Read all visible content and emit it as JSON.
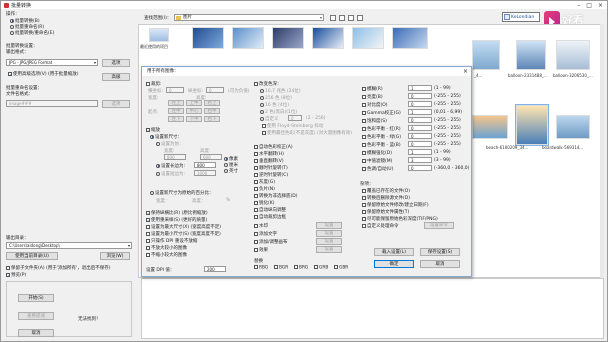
{
  "window": {
    "title": "批量转换"
  },
  "left": {
    "operation_label": "操作：",
    "ops": [
      {
        "label": "批量转换(B)",
        "selected": true
      },
      {
        "label": "批量重命名(R)",
        "selected": false
      },
      {
        "label": "批量转换/重命名(E)",
        "selected": false
      }
    ],
    "settings_label": "批量转换设置：",
    "output_format_label": "输出格式：",
    "format_value": "JPG - JPG/JPEG Format",
    "format_options_btn": "选项",
    "adv_check": "使用高级选项(V) (用于批量缩放)",
    "adv_btn": "高级",
    "rename_label": "批量重命名设置：",
    "name_pattern_label": "文件名格式：",
    "name_pattern_value": "image###",
    "name_options_btn": "选项",
    "output_dir_label": "输出目录：",
    "output_dir_value": "C:\\Users\\aidong\\Desktop\\",
    "use_current_dir_btn": "使用当前目录(U)",
    "browse_btn": "浏览(W)",
    "keep_subdirs_check": "保留子文件夹(A) (用于'添加所有'，退出后不保存)",
    "preview_check": "预览(P)",
    "start_btn": "开始(S)",
    "preview_btn": "查看提速",
    "cancel_btn": "取消",
    "status_text": "无法找到！"
  },
  "topbar": {
    "lookin_label": "查找范围(I)：",
    "path_value": "图片",
    "search_value": "KeLondian"
  },
  "thumbs": [
    {
      "label": "最近使用的项目"
    },
    {
      "label": ""
    },
    {
      "label": ""
    },
    {
      "label": ""
    },
    {
      "label": ""
    },
    {
      "label": ""
    },
    {
      "label": ""
    },
    {
      "label": "_4..."
    },
    {
      "label": "balloon-2331488_..."
    },
    {
      "label": "balloon-3206530_..."
    },
    {
      "label": "beach-6100209_34..."
    },
    {
      "label": "boardwalk-569314..."
    }
  ],
  "dialog": {
    "title": "用于所有图像：",
    "crop_check": "裁剪:",
    "crop_fields": {
      "start_x": "横坐标:",
      "start_y": "纵坐标:",
      "x_val": "0",
      "y_val": "0",
      "can_neg": "(可为负值)",
      "width": "宽度:",
      "height": "高度:"
    },
    "origin_label": "起点:",
    "origin_opts": [
      "左上",
      "上中",
      "右上",
      "左中",
      "中心",
      "右中",
      "左下",
      "下中",
      "右下"
    ],
    "resize_check": "缩放",
    "set_size_radio": "设置新尺寸：",
    "set_size_sub": "设置为仿：",
    "width_lbl": "宽度:",
    "height_lbl": "高度:",
    "w_val": "800",
    "h_val": "600",
    "set_long_radio": "设置长边为:",
    "long_val": "800",
    "unit_opts": [
      "像素",
      "厘米",
      "英寸"
    ],
    "set_short_radio": "设置短边为:",
    "short_val": "1000",
    "set_percent_radio": "设置新尺寸为原始的百分比：",
    "pct_w": "宽度：",
    "pct_h": "高度：",
    "pct_unit": "%",
    "keep_ratio_check": "保持纵横比(R) (原比例缩放)",
    "resample_check": "使用重采样(S) (更好的质量)",
    "apply_big_check": "设置为最大尺寸(X) (宽度高度不足)",
    "apply_small_check": "设置为最小尺寸(S) (宽度高度不足)",
    "dpi_check": "只操作 DPI 重设不放缩",
    "no_enlarge_check": "不放大较小的图像",
    "no_shrink_check": "不缩小较大的图像",
    "dpi_label": "设置 DPI 值：",
    "dpi_val": "200",
    "color_depth_check": "改变色深：",
    "depths": [
      "16,7 兆色 (24位)",
      "256 色 (8位)",
      "16 色 (4位)",
      "2 色(黑白)(1位)",
      "自定义"
    ],
    "depth_custom_val": "0",
    "depth_range": "(2 - 256)",
    "dither_check": "使用 Floyd-Steinberg 抖动",
    "best_check": "使用最佳色彩(不是灰度) (对大量图像有效)",
    "mid_checks": [
      "自动色彩校正(A)",
      "水平翻转(H)",
      "垂直翻转(V)",
      "顺时针旋转(T)",
      "逆时针旋转(C)",
      "灰度(G)",
      "负片(N)",
      "转换为非选择底(D)",
      "锐化(K)",
      "自动纵向调整",
      "自动裁剪边框"
    ],
    "watermark_check": "水印",
    "watermark_btn": "设置",
    "add_text_check": "添加文字",
    "add_text_btn": "设置",
    "canvas_check": "添加/调整画布",
    "canvas_btn": "设置",
    "effects_check": "效果",
    "effects_btn": "设置",
    "swap_label": "替换",
    "swap_channels": [
      "RBG",
      "BGR",
      "BRG",
      "GRB",
      "GBR"
    ],
    "adjustments": [
      {
        "label": "模糊(R)",
        "val": "1",
        "range": "(1 - 99)"
      },
      {
        "label": "亮度(B)",
        "val": "0",
        "range": "(-255 - 255)"
      },
      {
        "label": "对比度(O)",
        "val": "0",
        "range": "(-255 - 255)"
      },
      {
        "label": "Gamma校正(G)",
        "val": "1",
        "range": "(0,01 - 6,99)"
      },
      {
        "label": "饱和度(S)",
        "val": "0",
        "range": "(-255 - 255)"
      },
      {
        "label": "色彩平衡 - 红(R)",
        "val": "0",
        "range": "(-255 - 255)"
      },
      {
        "label": "色彩平衡 - 绿(G)",
        "val": "0",
        "range": "(-255 - 255)"
      },
      {
        "label": "色彩平衡 - 蓝(B)",
        "val": "0",
        "range": "(-255 - 255)"
      },
      {
        "label": "模糊强化(D)",
        "val": "1",
        "range": "(1 - 99)"
      },
      {
        "label": "中值滤镜(M)",
        "val": "3",
        "range": "(3 - 99)"
      },
      {
        "label": "色调/自动(U)",
        "val": "0",
        "range": "(-360,0 - 360,0)"
      }
    ],
    "misc_label": "杂项：",
    "misc_checks": [
      "覆盖已存在的文件(O)",
      "转换后删除源文件(D)",
      "保留原始文件修改/建立日期(F)",
      "保留原始文件属性(T)",
      "尽可能保留原始色彩深度(TIF/PNG)",
      "自定义处理命令"
    ],
    "misc_cmd_btn": "设置命令",
    "load_btn": "载入设置(L)",
    "save_btn": "保存设置(S)",
    "ok_btn": "确定",
    "cancel_btn": "取消"
  },
  "logo": {
    "text": "好看"
  }
}
